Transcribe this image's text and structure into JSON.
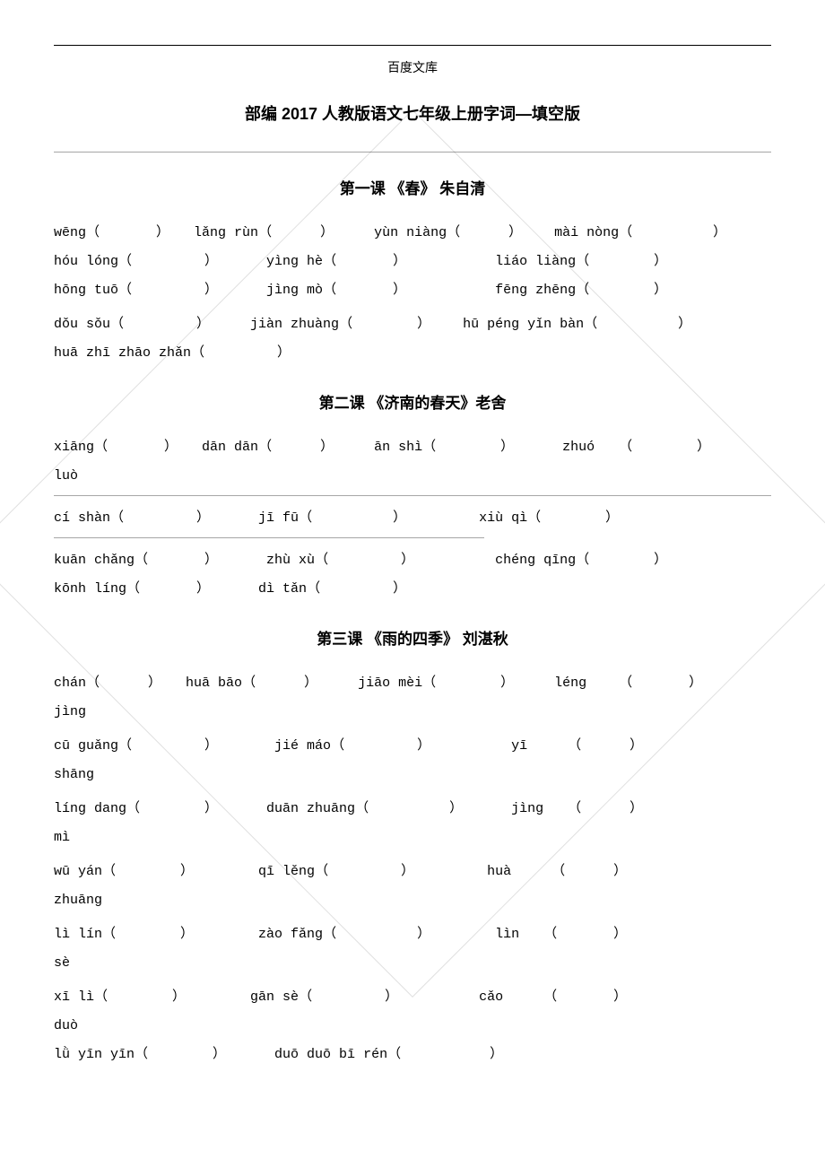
{
  "header": {
    "site": "百度文库"
  },
  "title": "部编 2017 人教版语文七年级上册字词—填空版",
  "lessons": [
    {
      "title": "第一课  《春》 朱自清",
      "rows": [
        [
          {
            "pinyin": "wēng",
            "paren": true
          },
          {
            "pinyin": "lǎng rùn",
            "paren": true
          },
          {
            "pinyin": "yùn niàng",
            "paren": true
          },
          {
            "pinyin": "mài nòng",
            "paren": true
          }
        ],
        [
          {
            "pinyin": "hóu lóng",
            "paren": true
          },
          {
            "pinyin": "yìng hè",
            "paren": true
          },
          {
            "pinyin": "liáo liàng",
            "paren": true
          }
        ],
        [
          {
            "pinyin": "hōng tuō",
            "paren": true
          },
          {
            "pinyin": "jìng mò",
            "paren": true
          },
          {
            "pinyin": "fēng zhēng",
            "paren": true
          }
        ],
        [
          {
            "pinyin": "dǒu sǒu",
            "paren": true
          },
          {
            "pinyin": "jiàn zhuàng",
            "paren": true
          },
          {
            "pinyin": "hū péng yǐn bàn",
            "paren": true
          }
        ],
        [
          {
            "pinyin": "huā zhī zhāo zhǎn",
            "paren": true
          }
        ]
      ]
    },
    {
      "title": "第二课  《济南的春天》老舍",
      "rows": [
        [
          {
            "pinyin": "xiāng",
            "paren": true
          },
          {
            "pinyin": "dān dān",
            "paren": true
          },
          {
            "pinyin": "ān shì",
            "paren": true
          },
          {
            "pinyin": "zhuó",
            "paren": true
          }
        ],
        [
          {
            "pinyin": "luò",
            "paren": false
          }
        ],
        [
          {
            "pinyin": "cí shàn",
            "paren": true
          },
          {
            "pinyin": "jī fū",
            "paren": true
          },
          {
            "pinyin": "xiù qì",
            "paren": true
          }
        ],
        [
          {
            "pinyin": "kuān chǎng",
            "paren": true
          },
          {
            "pinyin": "zhù xù",
            "paren": true
          },
          {
            "pinyin": "chéng qīng",
            "paren": true
          }
        ],
        [
          {
            "pinyin": "kōnh líng",
            "paren": true
          },
          {
            "pinyin": "dì tǎn",
            "paren": true
          }
        ]
      ]
    },
    {
      "title": "第三课  《雨的四季》  刘湛秋",
      "rows": [
        [
          {
            "pinyin": "chán",
            "paren": true
          },
          {
            "pinyin": "huā bāo",
            "paren": true
          },
          {
            "pinyin": "jiāo mèi",
            "paren": true
          },
          {
            "pinyin": "léng",
            "paren": true
          }
        ],
        [
          {
            "pinyin": "jìng",
            "paren": false
          }
        ],
        [
          {
            "pinyin": "cū guǎng",
            "paren": true
          },
          {
            "pinyin": "jié máo",
            "paren": true
          },
          {
            "pinyin": "yī",
            "paren": true
          }
        ],
        [
          {
            "pinyin": "shāng",
            "paren": false
          }
        ],
        [
          {
            "pinyin": "líng dang",
            "paren": true
          },
          {
            "pinyin": "duān zhuāng",
            "paren": true
          },
          {
            "pinyin": "jìng",
            "paren": true
          }
        ],
        [
          {
            "pinyin": "mì",
            "paren": false
          }
        ],
        [
          {
            "pinyin": "wū yán",
            "paren": true
          },
          {
            "pinyin": "qī lěng",
            "paren": true
          },
          {
            "pinyin": "huà",
            "paren": true
          }
        ],
        [
          {
            "pinyin": "zhuāng",
            "paren": false
          }
        ],
        [
          {
            "pinyin": "lì lín",
            "paren": true
          },
          {
            "pinyin": "zào fǎng",
            "paren": true
          },
          {
            "pinyin": "lìn",
            "paren": true
          }
        ],
        [
          {
            "pinyin": "sè",
            "paren": false
          }
        ],
        [
          {
            "pinyin": "xī lì",
            "paren": true
          },
          {
            "pinyin": "gān sè",
            "paren": true
          },
          {
            "pinyin": "cǎo",
            "paren": true
          }
        ],
        [
          {
            "pinyin": "duò",
            "paren": false
          }
        ],
        [
          {
            "pinyin": "lǜ yīn yīn",
            "paren": true
          },
          {
            "pinyin": "duō duō bī rén",
            "paren": true
          }
        ]
      ]
    }
  ],
  "parens": {
    "open": "（",
    "close": "）"
  }
}
